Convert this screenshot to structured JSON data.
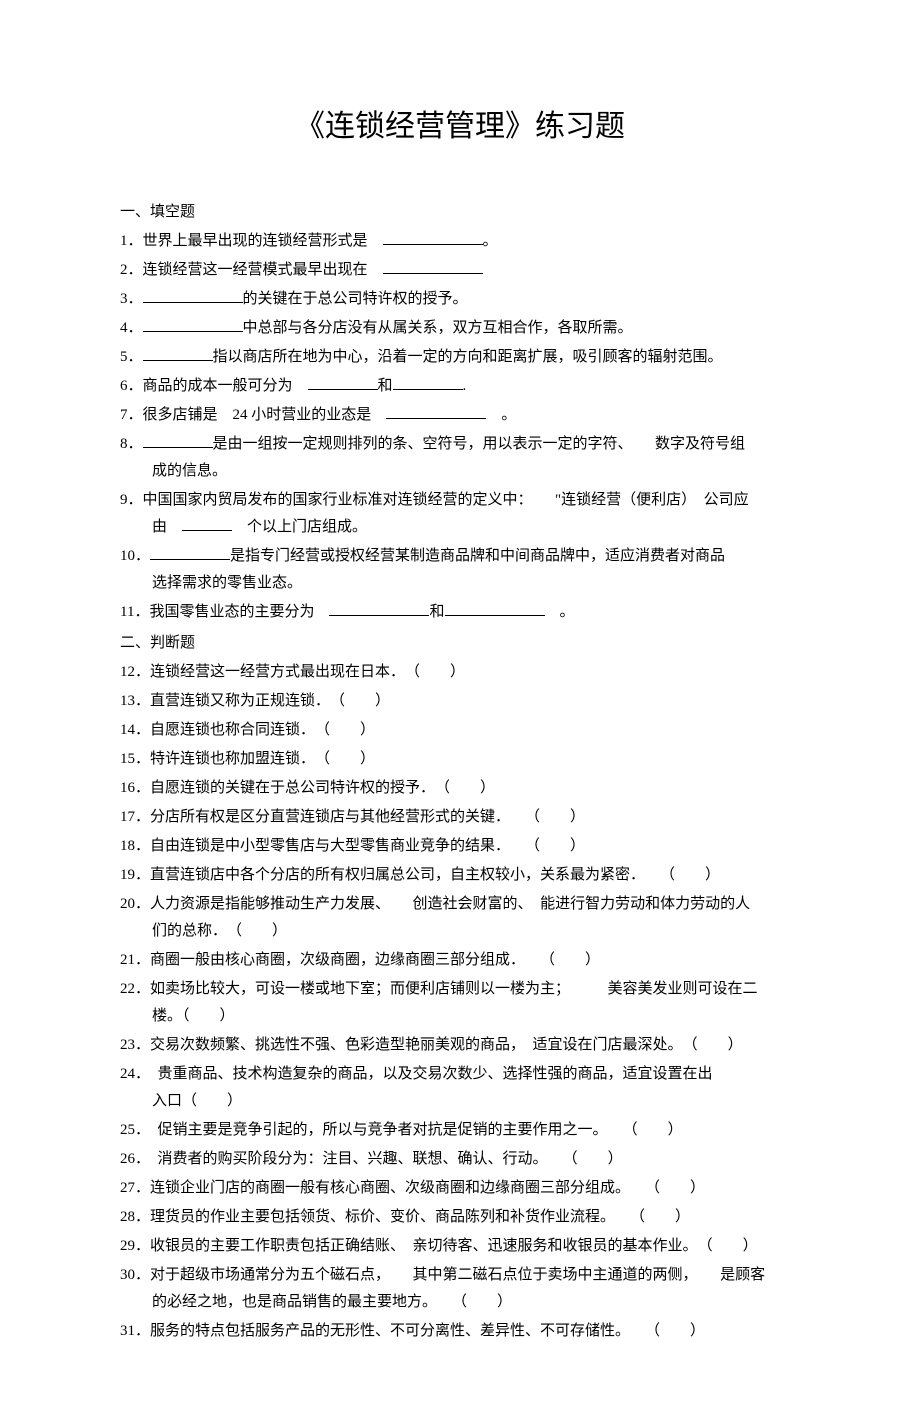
{
  "title": "《连锁经营管理》练习题",
  "sections": {
    "fill": "一、填空题",
    "judge": "二、判断题"
  },
  "q": {
    "1": {
      "num": "1",
      "t1": "．世界上最早出现的连锁经营形式是",
      "t2": "。"
    },
    "2": {
      "num": "2",
      "t1": "．连锁经营这一经营模式最早出现在"
    },
    "3": {
      "num": "3",
      "t1": "．",
      "t2": "的关键在于总公司特许权的授予。"
    },
    "4": {
      "num": "4",
      "t1": "．",
      "t2": "中总部与各分店没有从属关系，双方互相合作，各取所需。"
    },
    "5": {
      "num": "5",
      "t1": "．",
      "t2": "指以商店所在地为中心，沿着一定的方向和距离扩展，吸引顾客的辐射范围。"
    },
    "6": {
      "num": "6",
      "t1": "．商品的成本一般可分为",
      "t2": "和",
      "t3": "."
    },
    "7": {
      "num": "7",
      "t1": "．很多店铺是",
      "mid": "24",
      "t2": "小时营业的业态是",
      "t3": "。"
    },
    "8": {
      "num": "8",
      "t1": "．",
      "t2": "是由一组按一定规则排列的条、空符号，用以表示一定的字符、",
      "t3": "数字及符号组",
      "t4": "成的信息。"
    },
    "9": {
      "num": "9",
      "t1": "．中国国家内贸局发布的国家行业标准对连锁经营的定义中：",
      "t2": "\"连锁经营（便利店）",
      "t3": "公司应",
      "t4": "由",
      "t5": "个以上门店组成。"
    },
    "10": {
      "num": "10",
      "t1": "．",
      "t2": "是指专门经营或授权经营某制造商品牌和中间商品牌中，适应消费者对商品",
      "t3": "选择需求的零售业态。"
    },
    "11": {
      "num": "11",
      "t1": "．我国零售业态的主要分为",
      "t2": "和",
      "t3": "。"
    },
    "12": {
      "num": "12",
      "t1": "．连锁经营这一经营方式最出现在日本．",
      "p": "（　　）"
    },
    "13": {
      "num": "13",
      "t1": "．直营连锁又称为正规连锁．",
      "p": "（　　）"
    },
    "14": {
      "num": "14",
      "t1": "．自愿连锁也称合同连锁．",
      "p": "（　　）"
    },
    "15": {
      "num": "15",
      "t1": "．特许连锁也称加盟连锁．",
      "p": "（　　）"
    },
    "16": {
      "num": "16",
      "t1": "．自愿连锁的关键在于总公司特许权的授予．",
      "p": "（　　）"
    },
    "17": {
      "num": "17",
      "t1": "．分店所有权是区分直营连锁店与其他经营形式的关键．",
      "p": "（　　）"
    },
    "18": {
      "num": "18",
      "t1": "．自由连锁是中小型零售店与大型零售商业竞争的结果．",
      "p": "（　　）"
    },
    "19": {
      "num": "19",
      "t1": "．直营连锁店中各个分店的所有权归属总公司，自主权较小，关系最为紧密．",
      "p": "（　　）"
    },
    "20": {
      "num": "20",
      "t1": "．人力资源是指能够推动生产力发展、",
      "t2": "创造社会财富的、",
      "t3": "能进行智力劳动和体力劳动的人",
      "t4": "们的总称．",
      "p": "（　　）"
    },
    "21": {
      "num": "21",
      "t1": "．商圈一般由核心商圈，次级商圈，边缘商圈三部分组成．",
      "p": "（　　）"
    },
    "22": {
      "num": "22",
      "t1": "．如卖场比较大，可设一楼或地下室；而便利店铺则以一楼为主；",
      "t2": "美容美发业则可设在二",
      "t3": "楼。",
      "p": "（　　）"
    },
    "23": {
      "num": "23",
      "t1": "．交易次数频繁、挑选性不强、色彩造型艳丽美观的商品，",
      "t2": "适宜设在门店最深处。",
      "p": "（　　）"
    },
    "24": {
      "num": "24",
      "t1": "．",
      "t2": "贵重商品、技术构造复杂的商品，以及交易次数少、选择性强的商品，适宜设置在出",
      "t3": "入口",
      "p": "（　　）"
    },
    "25": {
      "num": "25",
      "t1": "．",
      "t2": "促销主要是竞争引起的，所以与竞争者对抗是促销的主要作用之一。",
      "p": "（　　）"
    },
    "26": {
      "num": "26",
      "t1": "．",
      "t2": "消费者的购买阶段分为：注目、兴趣、联想、确认、行动。",
      "p": "（　　）"
    },
    "27": {
      "num": "27",
      "t1": "．连锁企业门店的商圈一般有核心商圈、次级商圈和边缘商圈三部分组成。",
      "p": "（　　）"
    },
    "28": {
      "num": "28",
      "t1": "．理货员的作业主要包括领货、标价、变价、商品陈列和补货作业流程。",
      "p": "（　　）"
    },
    "29": {
      "num": "29",
      "t1": "．收银员的主要工作职责包括正确结账、",
      "t2": "亲切待客、迅速服务和收银员的基本作业。",
      "p": "（　　）"
    },
    "30": {
      "num": "30",
      "t1": "．对于超级市场通常分为五个磁石点，",
      "t2": "其中第二磁石点位于卖场中主通道的两侧，",
      "t3": "是顾客",
      "t4": "的必经之地，也是商品销售的最主要地方。",
      "p": "（　　）"
    },
    "31": {
      "num": "31",
      "t1": "．服务的特点包括服务产品的无形性、不可分离性、差异性、不可存储性。",
      "p": "（　　）"
    }
  }
}
